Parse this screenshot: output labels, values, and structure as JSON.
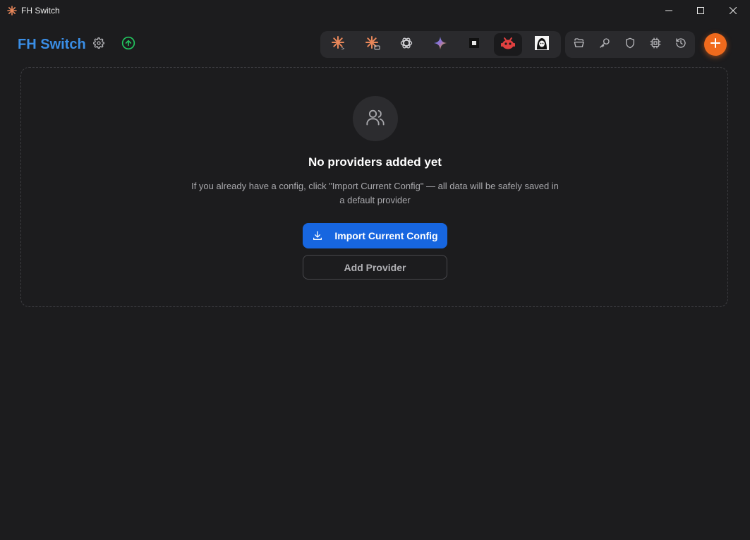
{
  "window": {
    "title": "FH Switch",
    "controls": [
      "minimize-icon",
      "maximize-icon",
      "close-icon"
    ]
  },
  "header": {
    "brand": "FH Switch",
    "settings_icon": "gear-icon",
    "update_icon": "arrow-up-circle-icon",
    "apps": [
      {
        "name": "claude-code-icon",
        "active": false
      },
      {
        "name": "claude-desktop-icon",
        "active": false
      },
      {
        "name": "openai-icon",
        "active": false
      },
      {
        "name": "gemini-icon",
        "active": false
      },
      {
        "name": "terminal-square-icon",
        "active": false
      },
      {
        "name": "red-bot-icon",
        "active": true
      },
      {
        "name": "character-avatar-icon",
        "active": false
      }
    ],
    "tools": [
      "folder-open-icon",
      "key-icon",
      "shield-icon",
      "chip-icon",
      "history-icon"
    ],
    "add_icon": "plus-icon"
  },
  "empty": {
    "icon": "users-icon",
    "title": "No providers added yet",
    "description": "If you already have a config, click \"Import Current Config\" — all data will be safely saved in a default provider",
    "import_label": "Import Current Config",
    "add_label": "Add Provider"
  },
  "colors": {
    "background": "#1c1c1e",
    "brand": "#3a8ee6",
    "primary": "#1766e0",
    "accent": "#f06a1d",
    "update": "#22c55e"
  }
}
